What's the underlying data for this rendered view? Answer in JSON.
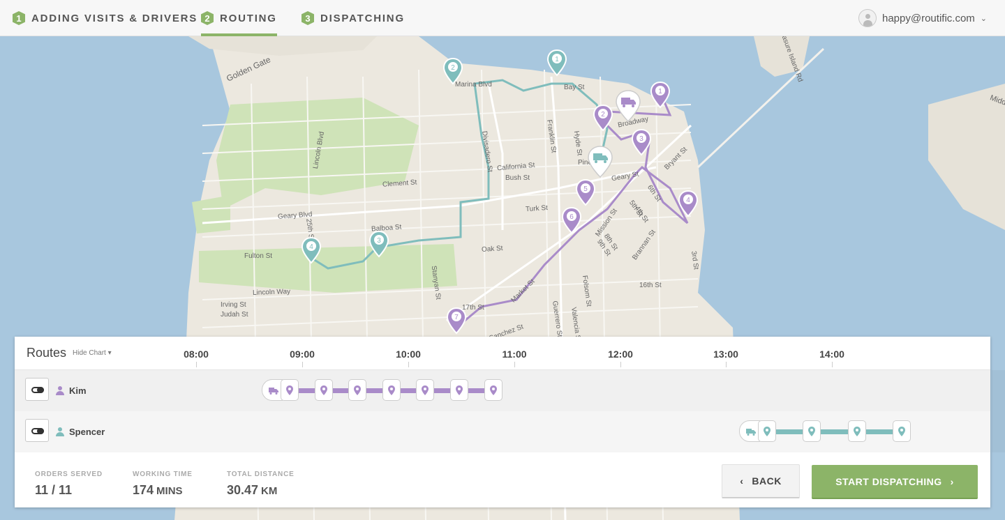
{
  "nav": {
    "steps": [
      {
        "number": "1",
        "label": "ADDING VISITS & DRIVERS"
      },
      {
        "number": "2",
        "label": "ROUTING"
      },
      {
        "number": "3",
        "label": "DISPATCHING"
      }
    ],
    "active_step": "ROUTING",
    "user_email": "happy@routific.com",
    "user_chevron": "⌄"
  },
  "map": {
    "labels": [
      "Golden Gate",
      "Marina Blvd",
      "Bay St",
      "Broadway",
      "Lincoln Blvd",
      "Divisadero St",
      "Franklin St",
      "Hyde St",
      "California St",
      "Bush St",
      "Pine St",
      "Geary St",
      "Clement St",
      "Geary Blvd",
      "Turk St",
      "Fulton St",
      "Balboa St",
      "Oak St",
      "Lincoln Way",
      "Irving St",
      "Judah St",
      "Stanyan St",
      "17th St",
      "Market St",
      "Mission St",
      "Folsom St",
      "16th St",
      "Guerrero St",
      "Valencia St",
      "Bryant St",
      "Brannan St",
      "Treasure Island Rd",
      "Midd",
      "3rd St",
      "4th St",
      "5th St",
      "8th St",
      "9th St",
      "6th St",
      "25th St",
      "Sanchez St"
    ],
    "kim_stops": [
      "1",
      "2",
      "3",
      "4",
      "5",
      "6",
      "7"
    ],
    "spencer_stops": [
      "1",
      "2",
      "3",
      "4"
    ]
  },
  "routes_panel": {
    "title": "Routes",
    "hide_chart": "Hide Chart",
    "times": [
      "08:00",
      "09:00",
      "10:00",
      "11:00",
      "12:00",
      "13:00",
      "14:00"
    ],
    "drivers": [
      {
        "name": "Kim",
        "color": "#a98bc9",
        "stops": 7,
        "start_hour": 8.75,
        "end_hour": 10.8
      },
      {
        "name": "Spencer",
        "color": "#7fbdbc",
        "stops": 4,
        "start_hour": 13.25,
        "end_hour": 14.65
      }
    ]
  },
  "stats": {
    "orders_label": "ORDERS SERVED",
    "orders_value": "11 / 11",
    "working_label": "WORKING TIME",
    "working_value": "174",
    "working_unit": "MINS",
    "distance_label": "TOTAL DISTANCE",
    "distance_value": "30.47",
    "distance_unit": "KM"
  },
  "buttons": {
    "back": "BACK",
    "start": "START DISPATCHING"
  },
  "colors": {
    "accent": "#8cb468",
    "kim": "#a98bc9",
    "spencer": "#7fbdbc"
  }
}
